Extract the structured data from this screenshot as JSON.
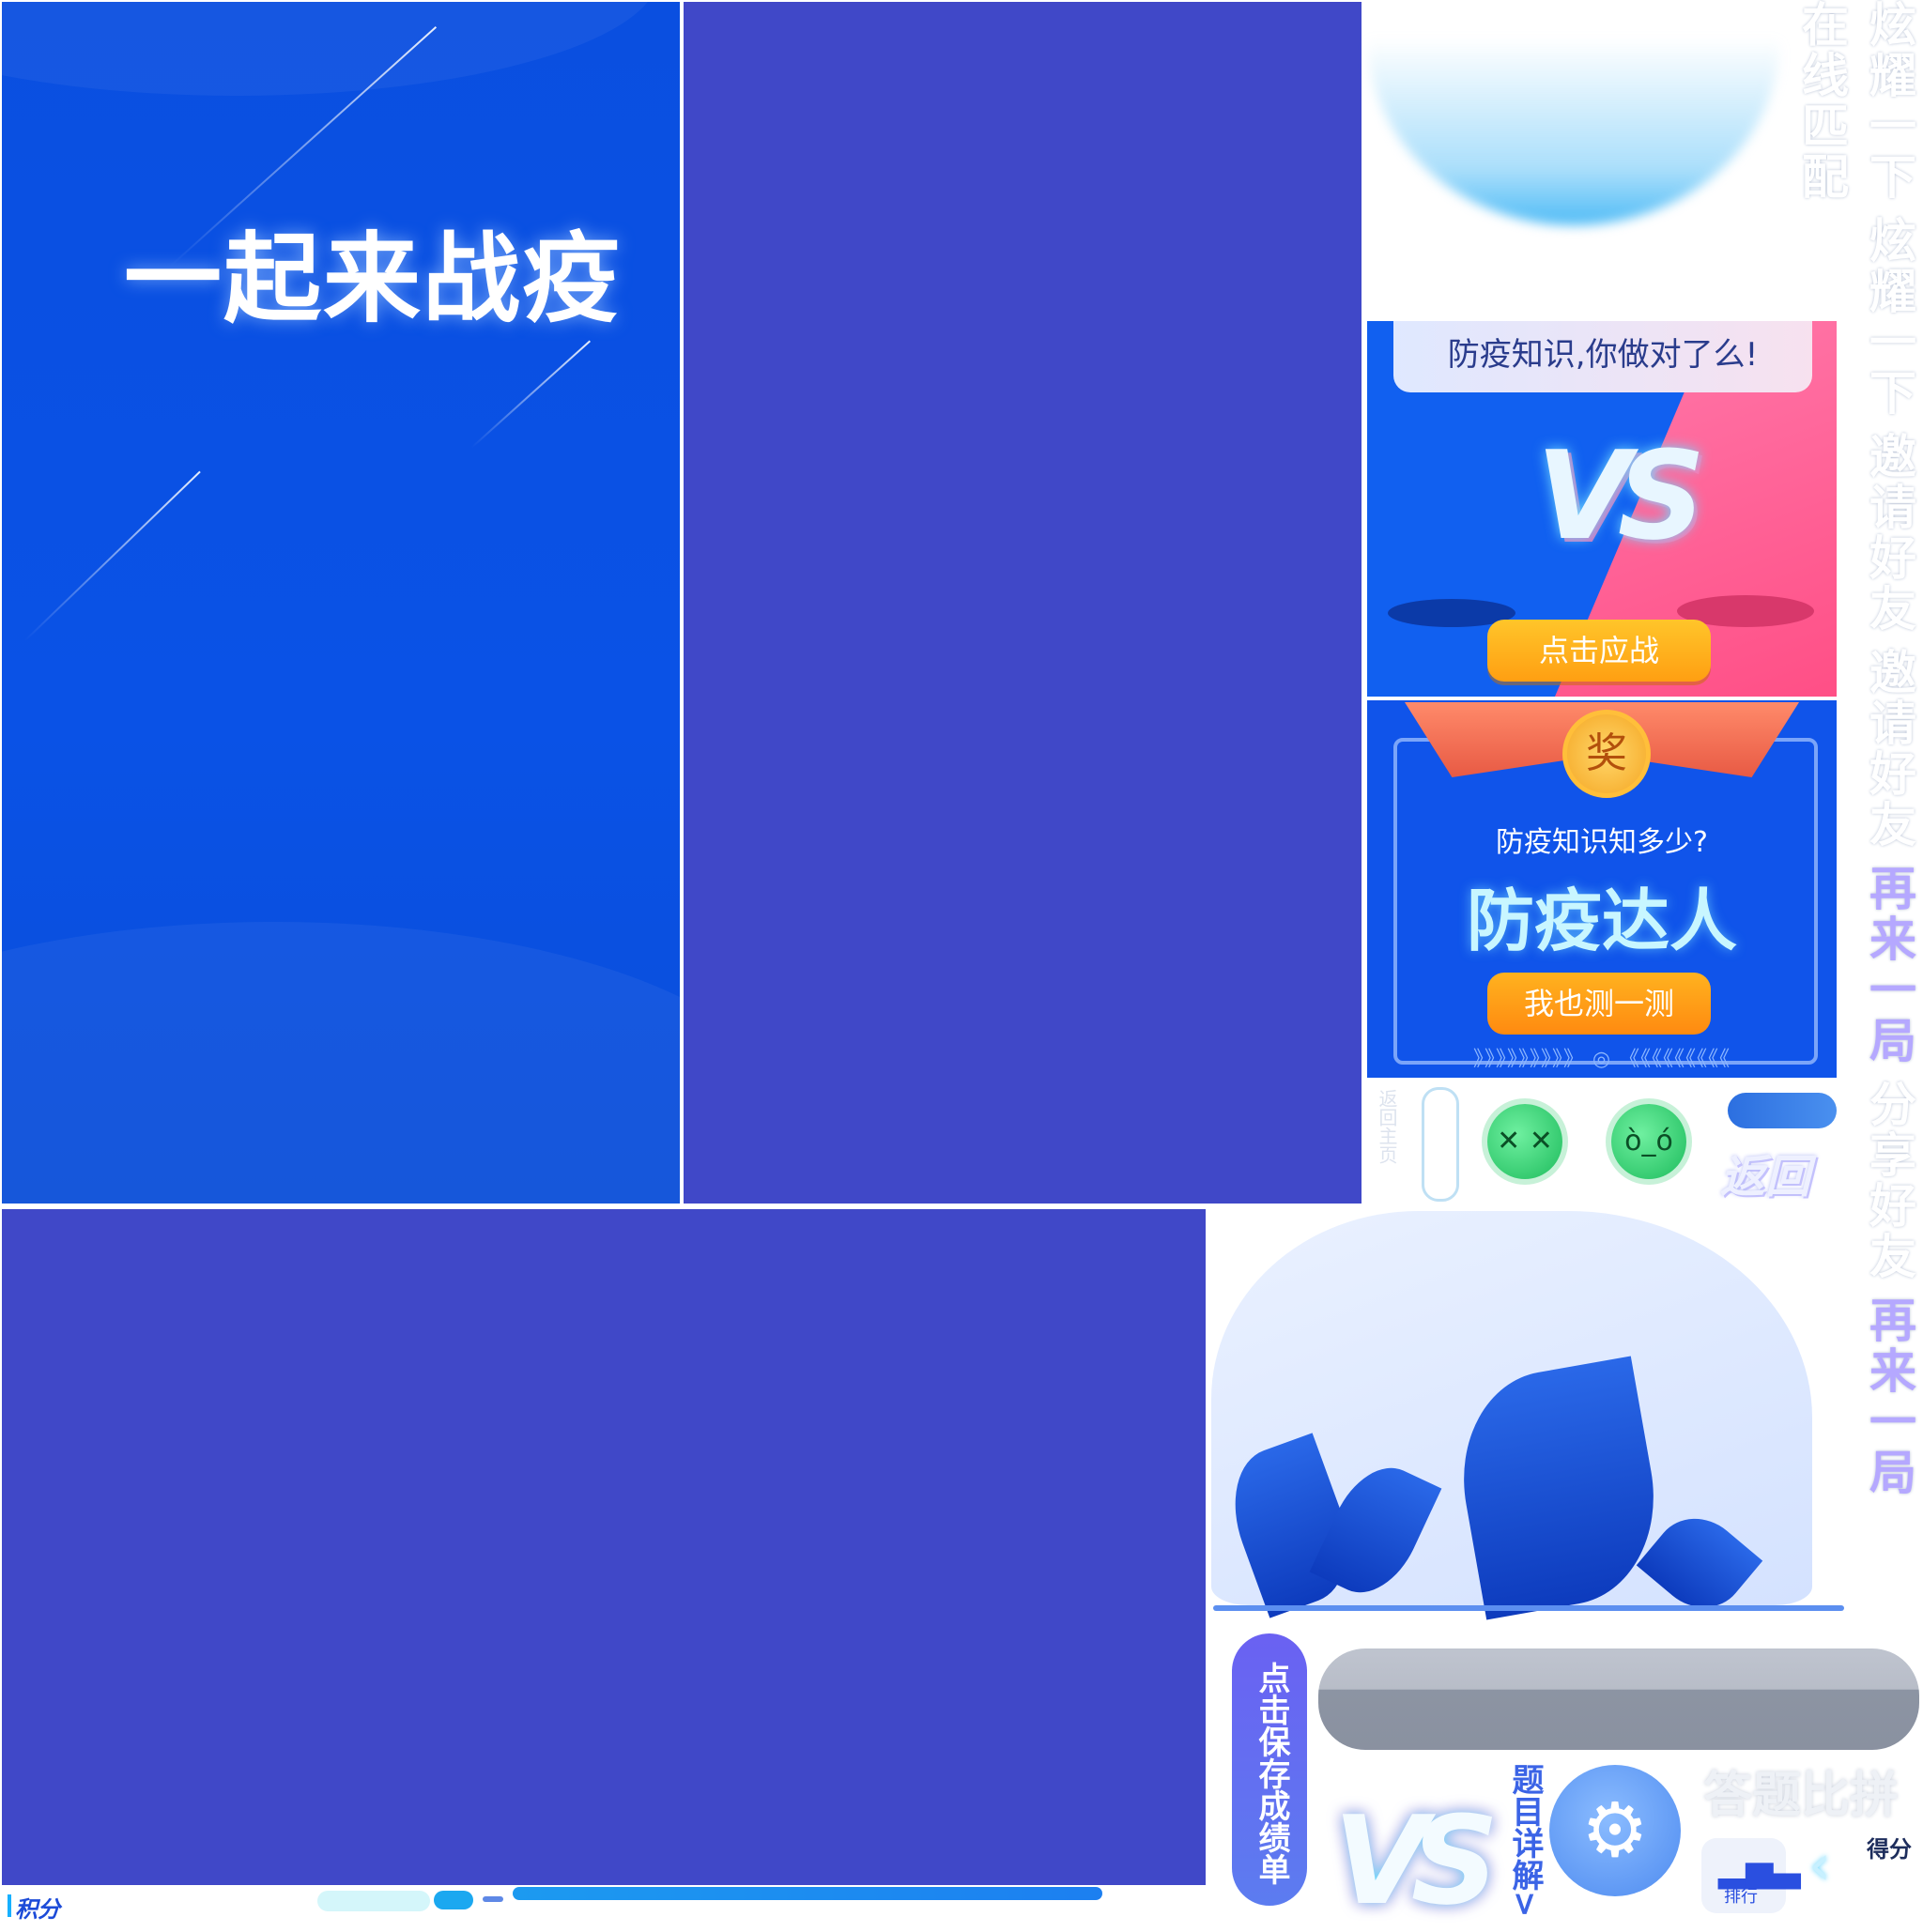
{
  "poster": {
    "title": "一起来战疫"
  },
  "vs_card": {
    "banner": "防疫知识,你做对了么!",
    "vs_text": "VS",
    "button": "点击应战"
  },
  "award_card": {
    "medal": "奖",
    "question": "防疫知识知多少?",
    "title": "防疫达人",
    "button": "我也测一测",
    "chevrons": "》》》》》》》》》 ◎ 《《《《《《《《《"
  },
  "small_elements": {
    "back_home": "返回主页",
    "virus_1_face": "✕ ✕",
    "virus_2_face": "ò_ó",
    "back_label": "返回"
  },
  "right_column": [
    {
      "text": "炫耀一下",
      "color": "#ffffff"
    },
    {
      "text": "炫耀一下",
      "color": "#ffffff"
    },
    {
      "text": "邀请好友",
      "color": "#ffffff"
    },
    {
      "text": "邀请好友",
      "color": "#ffffff"
    },
    {
      "text": "再来一局",
      "color": "#b5a8ff"
    },
    {
      "text": "分享好友",
      "color": "#ffffff"
    },
    {
      "text": "再来一局",
      "color": "#b5a8ff"
    },
    {
      "text": "在线匹配",
      "color": "#ffffff"
    }
  ],
  "save_button": {
    "label": "点击保存成绩单"
  },
  "bottom_cluster": {
    "vs_text": "VS",
    "question_detail": "题目详解>",
    "settings_icon": "⚙",
    "quiz_battle_title": "答题比拼",
    "score_label": "得分",
    "rank_icon": "▂▅▃",
    "rank_label": "排行",
    "back_chevron": "‹"
  },
  "bottom_strip": {
    "points_label": "积分"
  },
  "colors": {
    "poster_blue": "#0a4fe0",
    "panel_purple": "#4048c8",
    "vs_pink": "#ff4f86",
    "button_orange": "#ff9f12"
  }
}
